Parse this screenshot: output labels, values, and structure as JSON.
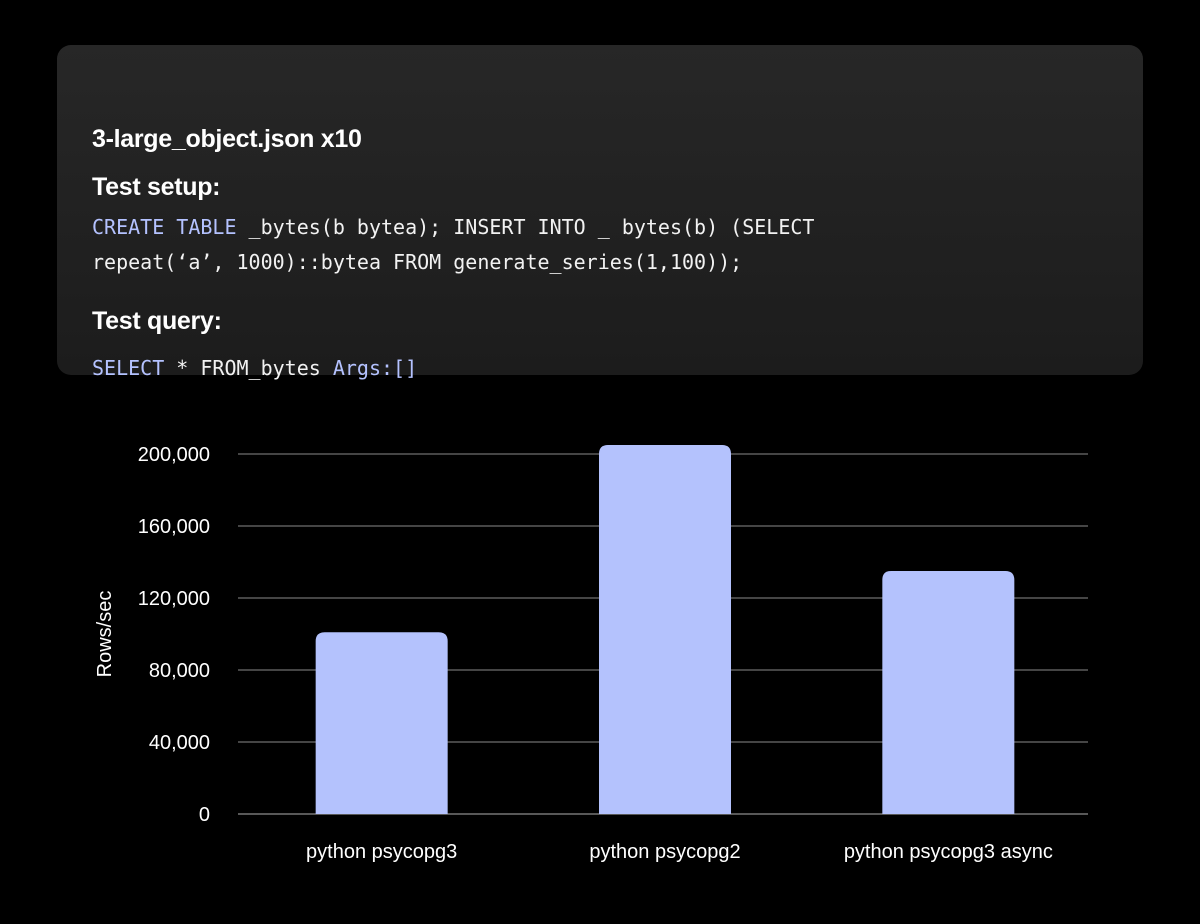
{
  "card": {
    "title": "3-large_object.json x10",
    "setup_heading": "Test setup:",
    "setup_line1": [
      {
        "text": "CREATE TABLE",
        "kw": true
      },
      {
        "text": " _bytes(b bytea); INSERT INTO _ bytes(b) (SELECT",
        "kw": false
      }
    ],
    "setup_line2": [
      {
        "text": "repeat(‘a’, 1000)::bytea FROM generate_series(1,100));",
        "kw": false
      }
    ],
    "query_heading": "Test query:",
    "query_line": [
      {
        "text": "SELECT",
        "kw": true
      },
      {
        "text": " * FROM_bytes ",
        "kw": false
      },
      {
        "text": "Args:[]",
        "kw": true
      }
    ]
  },
  "colors": {
    "background": "#000000",
    "card": "#232323",
    "bar": "#b4c2fd",
    "keyword": "#b4c2ff",
    "grid": "#8a8a8a"
  },
  "chart_data": {
    "type": "bar",
    "categories": [
      "python psycopg3",
      "python psycopg2",
      "python psycopg3 async"
    ],
    "values": [
      101000,
      205000,
      135000
    ],
    "ylabel": "Rows/sec",
    "xlabel": "",
    "ylim": [
      0,
      200000
    ],
    "yticks": [
      0,
      40000,
      80000,
      120000,
      160000,
      200000
    ],
    "ytick_labels": [
      "0",
      "40,000",
      "80,000",
      "120,000",
      "160,000",
      "200,000"
    ],
    "grid": true,
    "legend": "none"
  }
}
